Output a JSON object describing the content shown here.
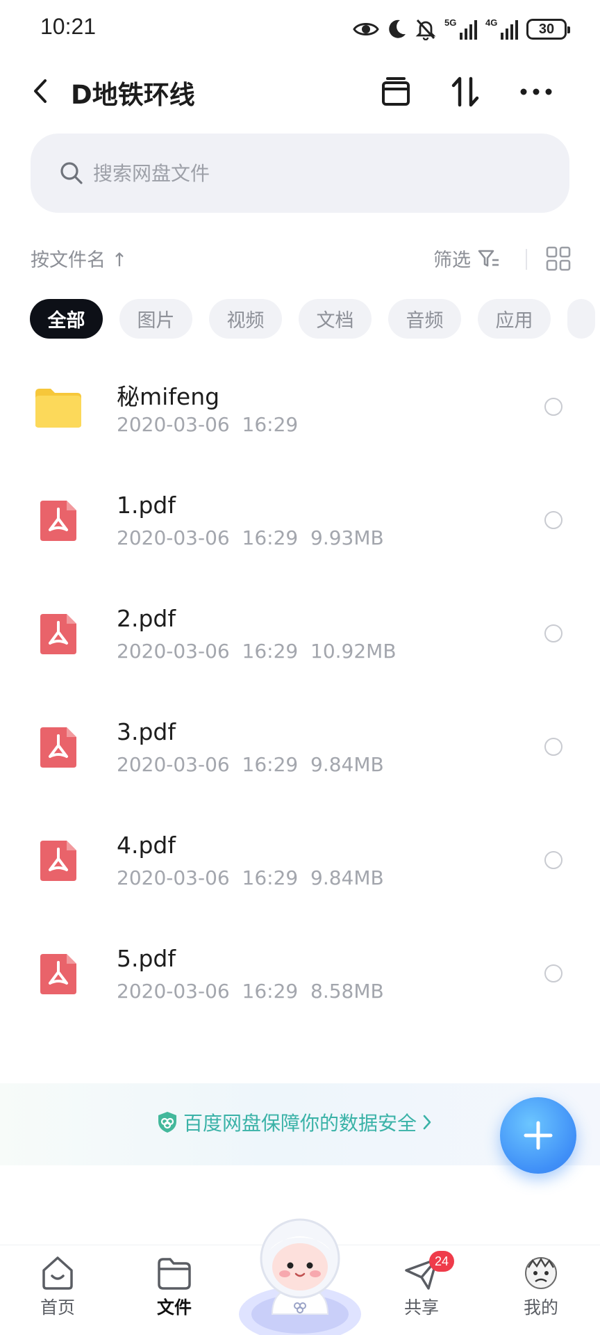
{
  "status_bar": {
    "time": "10:21",
    "net1": "5G",
    "net2": "4G",
    "battery": "30"
  },
  "header": {
    "title": "D地铁环线"
  },
  "search": {
    "placeholder": "搜索网盘文件"
  },
  "sort": {
    "label": "按文件名 ↑",
    "filter_label": "筛选"
  },
  "chips": [
    "全部",
    "图片",
    "视频",
    "文档",
    "音频",
    "应用"
  ],
  "files": [
    {
      "name": "秘mifeng",
      "meta": "2020-03-06  16:29",
      "type": "folder"
    },
    {
      "name": "1.pdf",
      "meta": "2020-03-06  16:29  9.93MB",
      "type": "pdf"
    },
    {
      "name": "2.pdf",
      "meta": "2020-03-06  16:29  10.92MB",
      "type": "pdf"
    },
    {
      "name": "3.pdf",
      "meta": "2020-03-06  16:29  9.84MB",
      "type": "pdf"
    },
    {
      "name": "4.pdf",
      "meta": "2020-03-06  16:29  9.84MB",
      "type": "pdf"
    },
    {
      "name": "5.pdf",
      "meta": "2020-03-06  16:29  8.58MB",
      "type": "pdf"
    }
  ],
  "banner": {
    "text": "百度网盘保障你的数据安全"
  },
  "nav": {
    "home": "首页",
    "files": "文件",
    "share": "共享",
    "share_badge": "24",
    "mine": "我的"
  },
  "colors": {
    "accent": "#3f8ff7",
    "pdf_red": "#e9636a",
    "folder_yellow": "#fbd54a",
    "banner_text": "#3ab2a7",
    "badge": "#ef3b4a"
  }
}
